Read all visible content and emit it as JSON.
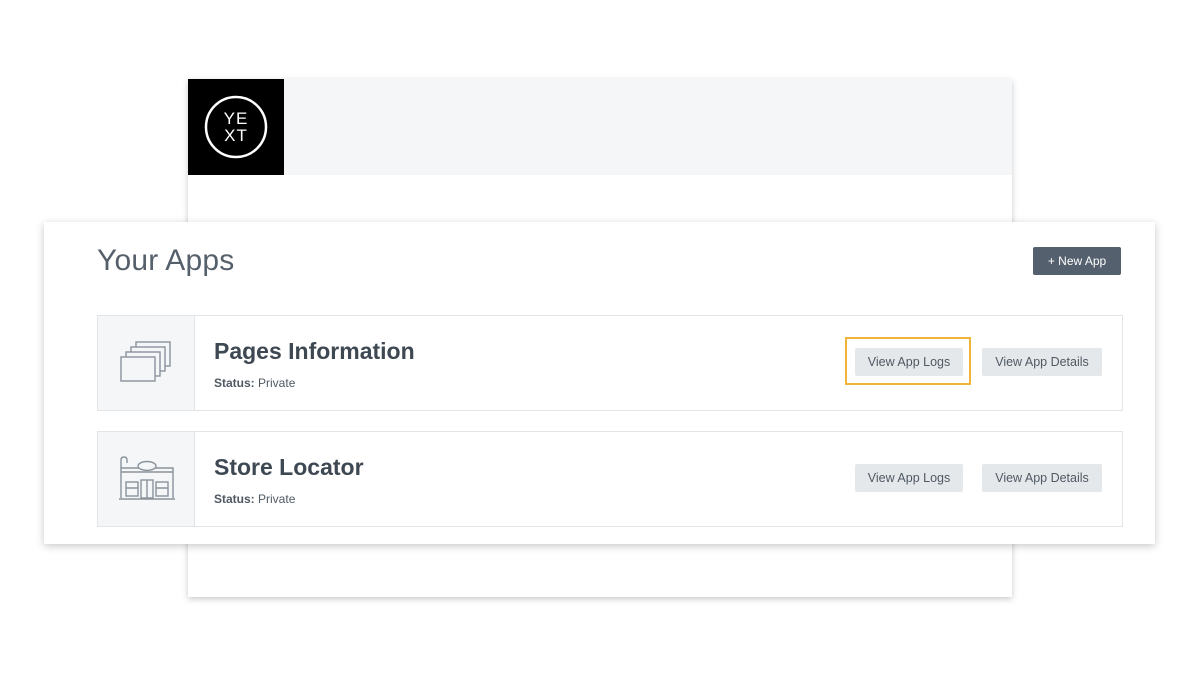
{
  "brand": {
    "logo_line1": "YE",
    "logo_line2": "XT"
  },
  "apps_panel": {
    "title": "Your Apps",
    "new_app_label": "+ New App"
  },
  "apps": [
    {
      "name": "Pages Information",
      "status_label": "Status:",
      "status_value": "Private",
      "icon": "stacked-pages-icon",
      "view_logs_label": "View App Logs",
      "view_details_label": "View App Details",
      "logs_highlighted": true
    },
    {
      "name": "Store Locator",
      "status_label": "Status:",
      "status_value": "Private",
      "icon": "storefront-icon",
      "view_logs_label": "View App Logs",
      "view_details_label": "View App Details",
      "logs_highlighted": false
    }
  ],
  "colors": {
    "logo_background": "#000000",
    "primary_button": "#55606e",
    "secondary_button": "#e5e8eb",
    "highlight_outline": "#f0b43a",
    "text_dark": "#3e4852"
  }
}
